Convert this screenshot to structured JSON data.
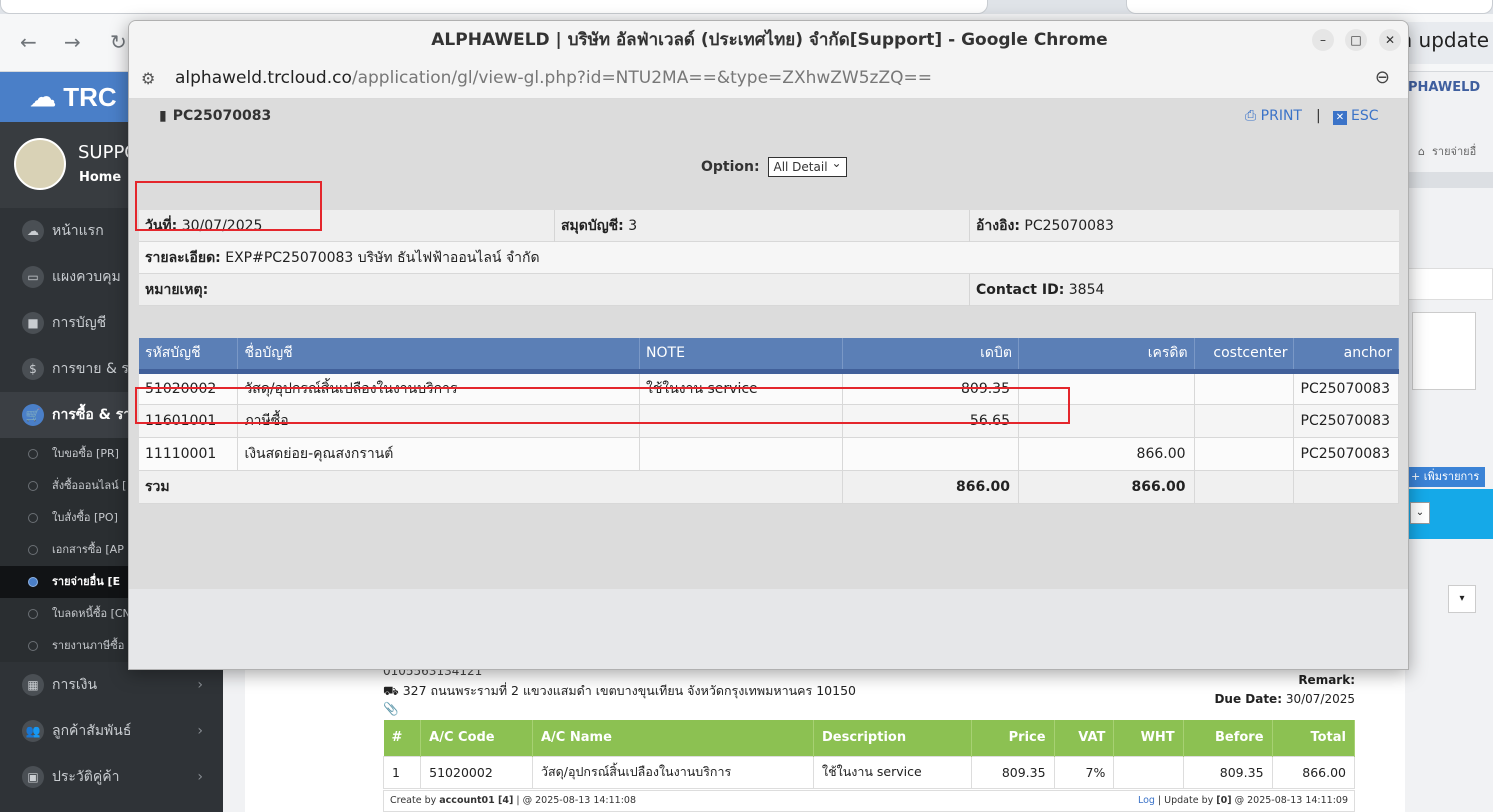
{
  "bg_browser": {
    "update_label": "sh update"
  },
  "bg_sidebar": {
    "logo": "TRC",
    "profile_name": "SUPPO",
    "home_label": "Home",
    "menu": [
      {
        "label": "หน้าแรก",
        "icon": "cloud-icon",
        "glyph": "☁"
      },
      {
        "label": "แผงควบคุม",
        "icon": "monitor-icon",
        "glyph": "▭"
      },
      {
        "label": "การบัญชี",
        "icon": "book-icon",
        "glyph": "■"
      },
      {
        "label": "การขาย & ร",
        "icon": "dollar-icon",
        "glyph": "$"
      },
      {
        "label": "การซื้อ & รา",
        "icon": "cart-icon",
        "glyph": "🛒"
      }
    ],
    "submenu": [
      "ใบขอซื้อ [PR]",
      "สั่งซื้อออนไลน์ [",
      "ใบสั่งซื้อ [PO]",
      "เอกสารซื้อ [AP",
      "รายจ่ายอื่น [E",
      "ใบลดหนี้ซื้อ [CN",
      "รายงานภาษีซื้อ"
    ],
    "menu_after": [
      {
        "label": "การเงิน",
        "icon": "calendar-icon",
        "glyph": "▦"
      },
      {
        "label": "ลูกค้าสัมพันธ์",
        "icon": "users-icon",
        "glyph": "👥"
      },
      {
        "label": "ประวัติคู่ค้า",
        "icon": "contact-icon",
        "glyph": "▣"
      }
    ]
  },
  "bg_right": {
    "header": "PHAWELD",
    "crumb": "รายจ่ายอื่",
    "add_button": "เพิ่มรายการ"
  },
  "bg_doc": {
    "taxid": "0105563134121",
    "address": "327 ถนนพระรามที่ 2 แขวงแสมดำ เขตบางขุนเทียน จังหวัดกรุงเทพมหานคร 10150",
    "remark_label": "Remark:",
    "due_label": "Due Date:",
    "due_value": "30/07/2025",
    "columns": [
      "#",
      "A/C Code",
      "A/C Name",
      "Description",
      "Price",
      "VAT",
      "WHT",
      "Before",
      "Total"
    ],
    "row": [
      "1",
      "51020002",
      "วัสดุ/อุปกรณ์สิ้นเปลืองในงานบริการ",
      "ใช้ในงาน service",
      "809.35",
      "7%",
      "",
      "809.35",
      "866.00"
    ],
    "footer_left_prefix": "Create by ",
    "footer_left_user": "account01 [4]",
    "footer_left_suffix": " | @ 2025-08-13 14:11:08",
    "footer_right_log": "Log",
    "footer_right_mid": " | Update by ",
    "footer_right_user": "[0]",
    "footer_right_suffix": " @ 2025-08-13 14:11:09"
  },
  "popup": {
    "window_title": "ALPHAWELD | บริษัท อัลฟ่าเวลด์ (ประเทศไทย) จำกัด[Support] - Google Chrome",
    "url_host": "alphaweld.trcloud.co",
    "url_path": "/application/gl/view-gl.php?id=NTU2MA==&type=ZXhwZW5zZQ==",
    "doc_no": "PC25070083",
    "print_label": "PRINT",
    "separator": "|",
    "esc_label": "ESC",
    "option_label": "Option:",
    "option_value": "All Detail",
    "info": {
      "date_label": "วันที่:",
      "date_value": "30/07/2025",
      "journal_label": "สมุดบัญชี:",
      "journal_value": "3",
      "ref_label": "อ้างอิง:",
      "ref_value": "PC25070083",
      "detail_label": "รายละเอียด:",
      "detail_value": "EXP#PC25070083 บริษัท ธันไฟฟ้าออนไลน์ จำกัด",
      "note_label": "หมายเหตุ:",
      "contact_label": "Contact ID:",
      "contact_value": "3854"
    },
    "gl_columns": [
      "รหัสบัญชี",
      "ชื่อบัญชี",
      "NOTE",
      "เดบิต",
      "เครดิต",
      "costcenter",
      "anchor"
    ],
    "gl_rows": [
      [
        "51020002",
        "วัสดุ/อุปกรณ์สิ้นเปลืองในงานบริการ",
        "ใช้ในงาน service",
        "809.35",
        "",
        "",
        "PC25070083"
      ],
      [
        "11601001",
        "ภาษีซื้อ",
        "",
        "56.65",
        "",
        "",
        "PC25070083"
      ],
      [
        "11110001",
        "เงินสดย่อย-คุณสงกรานต์",
        "",
        "",
        "866.00",
        "",
        "PC25070083"
      ]
    ],
    "total_label": "รวม",
    "total_debit": "866.00",
    "total_credit": "866.00"
  }
}
